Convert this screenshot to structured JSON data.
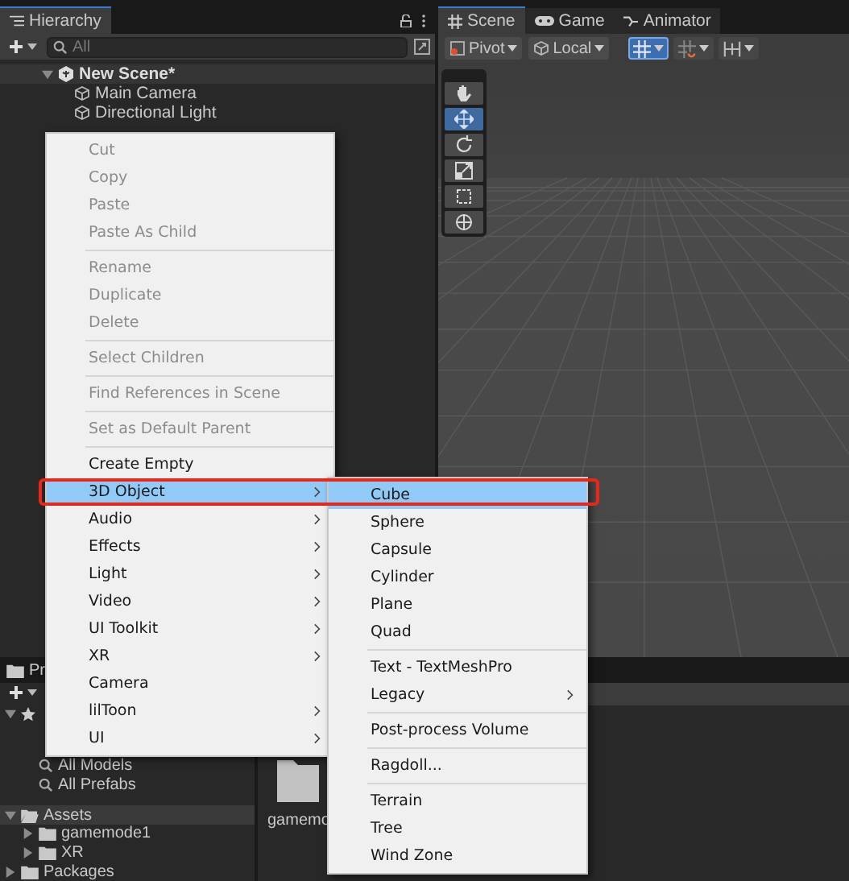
{
  "hierarchy": {
    "title": "Hierarchy",
    "search": {
      "placeholder": "All"
    },
    "scene": {
      "name": "New Scene*",
      "expanded": true,
      "children": [
        {
          "name": "Main Camera"
        },
        {
          "name": "Directional Light"
        }
      ]
    }
  },
  "scene_view": {
    "tabs": [
      {
        "label": "Scene",
        "kind": "grid",
        "selected": true
      },
      {
        "label": "Game",
        "kind": "gamepad",
        "selected": false
      },
      {
        "label": "Animator",
        "kind": "branch",
        "selected": false
      }
    ],
    "pivot": "Pivot",
    "space": "Local",
    "view_buttons": [
      {
        "kind": "grid-snap",
        "selected": true
      },
      {
        "kind": "increment-snap",
        "selected": false
      },
      {
        "kind": "align",
        "selected": false
      }
    ],
    "tools": [
      {
        "kind": "hand",
        "selected": false
      },
      {
        "kind": "move",
        "selected": true
      },
      {
        "kind": "rotate",
        "selected": false
      },
      {
        "kind": "scale",
        "selected": false
      },
      {
        "kind": "rect",
        "selected": false
      },
      {
        "kind": "transform",
        "selected": false
      }
    ]
  },
  "project": {
    "tab": "Pr",
    "favorites": {
      "expanded": true,
      "items": [
        "All Models",
        "All Prefabs"
      ]
    },
    "tree": [
      {
        "name": "Assets",
        "selected": true,
        "expanded": true,
        "children": [
          {
            "name": "gamemode1"
          },
          {
            "name": "XR"
          }
        ]
      },
      {
        "name": "Packages",
        "selected": false,
        "expanded": false
      }
    ],
    "grid_items": [
      {
        "name": "gamemo"
      }
    ]
  },
  "context_menu": {
    "items": [
      {
        "kind": "item",
        "label": "Cut",
        "disabled": true,
        "submenu": false,
        "selected": false
      },
      {
        "kind": "item",
        "label": "Copy",
        "disabled": true,
        "submenu": false,
        "selected": false
      },
      {
        "kind": "item",
        "label": "Paste",
        "disabled": true,
        "submenu": false,
        "selected": false
      },
      {
        "kind": "item",
        "label": "Paste As Child",
        "disabled": true,
        "submenu": false,
        "selected": false
      },
      {
        "kind": "separator"
      },
      {
        "kind": "item",
        "label": "Rename",
        "disabled": true,
        "submenu": false,
        "selected": false
      },
      {
        "kind": "item",
        "label": "Duplicate",
        "disabled": true,
        "submenu": false,
        "selected": false
      },
      {
        "kind": "item",
        "label": "Delete",
        "disabled": true,
        "submenu": false,
        "selected": false
      },
      {
        "kind": "separator"
      },
      {
        "kind": "item",
        "label": "Select Children",
        "disabled": true,
        "submenu": false,
        "selected": false
      },
      {
        "kind": "separator"
      },
      {
        "kind": "item",
        "label": "Find References in Scene",
        "disabled": true,
        "submenu": false,
        "selected": false
      },
      {
        "kind": "separator"
      },
      {
        "kind": "item",
        "label": "Set as Default Parent",
        "disabled": true,
        "submenu": false,
        "selected": false
      },
      {
        "kind": "separator"
      },
      {
        "kind": "item",
        "label": "Create Empty",
        "disabled": false,
        "submenu": false,
        "selected": false
      },
      {
        "kind": "item",
        "label": "3D Object",
        "disabled": false,
        "submenu": true,
        "selected": true
      },
      {
        "kind": "item",
        "label": "Audio",
        "disabled": false,
        "submenu": true,
        "selected": false
      },
      {
        "kind": "item",
        "label": "Effects",
        "disabled": false,
        "submenu": true,
        "selected": false
      },
      {
        "kind": "item",
        "label": "Light",
        "disabled": false,
        "submenu": true,
        "selected": false
      },
      {
        "kind": "item",
        "label": "Video",
        "disabled": false,
        "submenu": true,
        "selected": false
      },
      {
        "kind": "item",
        "label": "UI Toolkit",
        "disabled": false,
        "submenu": true,
        "selected": false
      },
      {
        "kind": "item",
        "label": "XR",
        "disabled": false,
        "submenu": true,
        "selected": false
      },
      {
        "kind": "item",
        "label": "Camera",
        "disabled": false,
        "submenu": false,
        "selected": false
      },
      {
        "kind": "item",
        "label": "lilToon",
        "disabled": false,
        "submenu": true,
        "selected": false
      },
      {
        "kind": "item",
        "label": "UI",
        "disabled": false,
        "submenu": true,
        "selected": false
      }
    ]
  },
  "submenu": {
    "items": [
      {
        "kind": "item",
        "label": "Cube",
        "disabled": false,
        "submenu": false,
        "selected": true
      },
      {
        "kind": "item",
        "label": "Sphere",
        "disabled": false,
        "submenu": false,
        "selected": false
      },
      {
        "kind": "item",
        "label": "Capsule",
        "disabled": false,
        "submenu": false,
        "selected": false
      },
      {
        "kind": "item",
        "label": "Cylinder",
        "disabled": false,
        "submenu": false,
        "selected": false
      },
      {
        "kind": "item",
        "label": "Plane",
        "disabled": false,
        "submenu": false,
        "selected": false
      },
      {
        "kind": "item",
        "label": "Quad",
        "disabled": false,
        "submenu": false,
        "selected": false
      },
      {
        "kind": "separator"
      },
      {
        "kind": "item",
        "label": "Text - TextMeshPro",
        "disabled": false,
        "submenu": false,
        "selected": false
      },
      {
        "kind": "item",
        "label": "Legacy",
        "disabled": false,
        "submenu": true,
        "selected": false
      },
      {
        "kind": "separator"
      },
      {
        "kind": "item",
        "label": "Post-process Volume",
        "disabled": false,
        "submenu": false,
        "selected": false
      },
      {
        "kind": "separator"
      },
      {
        "kind": "item",
        "label": "Ragdoll...",
        "disabled": false,
        "submenu": false,
        "selected": false
      },
      {
        "kind": "separator"
      },
      {
        "kind": "item",
        "label": "Terrain",
        "disabled": false,
        "submenu": false,
        "selected": false
      },
      {
        "kind": "item",
        "label": "Tree",
        "disabled": false,
        "submenu": false,
        "selected": false
      },
      {
        "kind": "item",
        "label": "Wind Zone",
        "disabled": false,
        "submenu": false,
        "selected": false
      }
    ]
  },
  "highlight_frame": true
}
